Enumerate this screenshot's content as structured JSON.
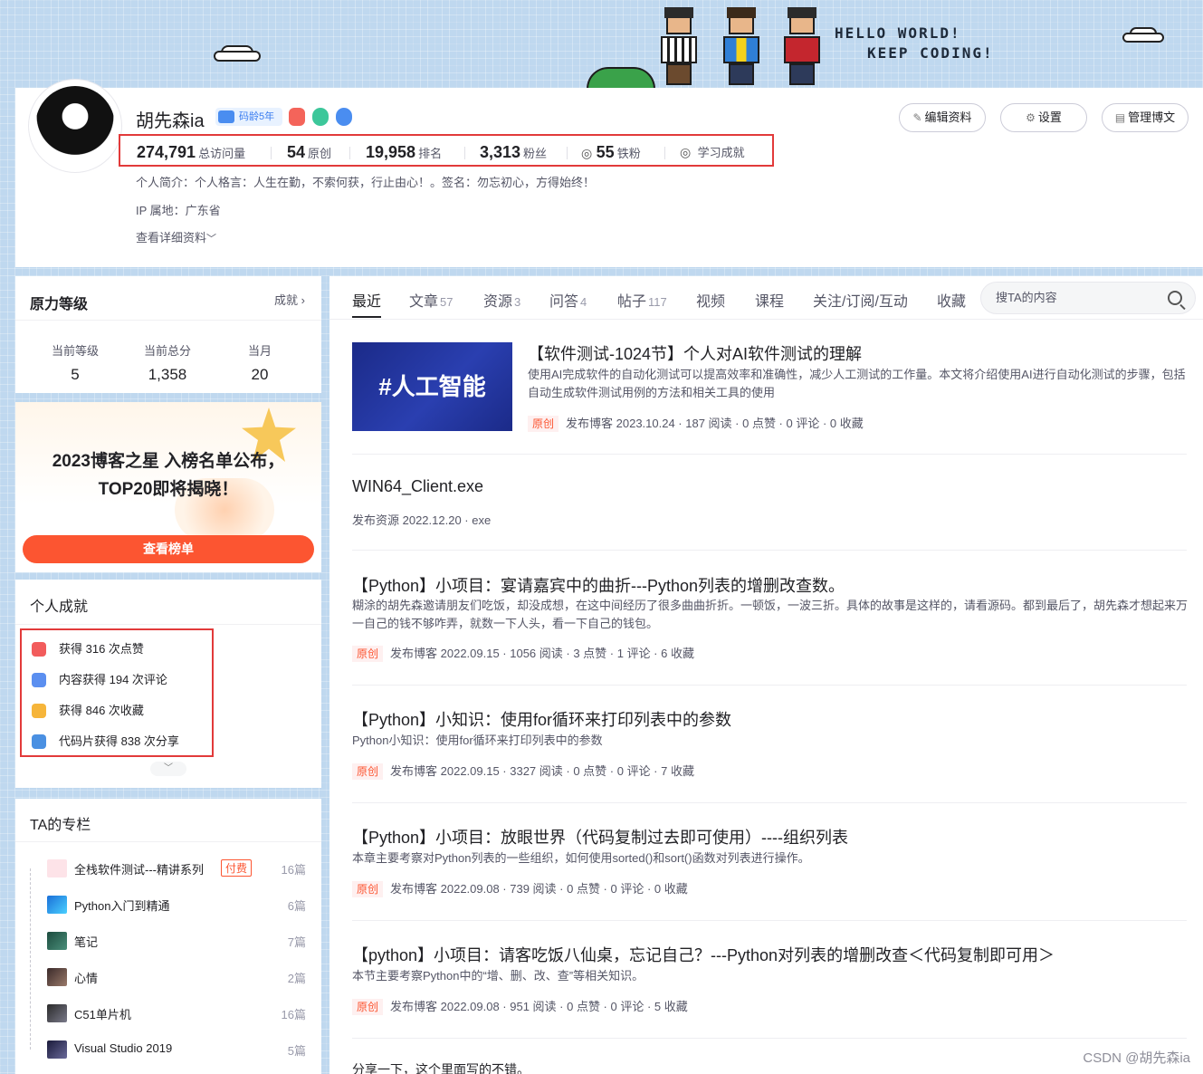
{
  "banner": {
    "hello_line1": "HELLO WORLD!",
    "hello_line2": "KEEP CODING!"
  },
  "profile": {
    "name": "胡先森ia",
    "code_age": "码龄5年",
    "stats": [
      {
        "num": "274,791",
        "label": "总访问量"
      },
      {
        "num": "54",
        "label": "原创"
      },
      {
        "num": "19,958",
        "label": "排名"
      },
      {
        "num": "3,313",
        "label": "粉丝"
      },
      {
        "num": "55",
        "label": "铁粉"
      },
      {
        "num": "",
        "label": "学习成就"
      }
    ],
    "intro": "个人简介：个人格言：人生在勤，不索何获，行止由心！。签名：勿忘初心，方得始终！",
    "ip": "IP 属地：广东省",
    "details": "查看详细资料",
    "buttons": {
      "edit": "编辑资料",
      "settings": "设置",
      "manage": "管理博文"
    }
  },
  "level": {
    "title": "原力等级",
    "link": "成就",
    "items": [
      {
        "label": "当前等级",
        "value": "5"
      },
      {
        "label": "当前总分",
        "value": "1,358"
      },
      {
        "label": "当月",
        "value": "20"
      }
    ]
  },
  "promo": {
    "line1": "2023博客之星 入榜名单公布，",
    "line2": "TOP20即将揭晓！",
    "button": "查看榜单"
  },
  "achievements": {
    "title": "个人成就",
    "items": [
      {
        "text": "获得 316 次点赞",
        "color": "#f25c5c"
      },
      {
        "text": "内容获得 194 次评论",
        "color": "#5b8ff0"
      },
      {
        "text": "获得 846 次收藏",
        "color": "#f6b53a"
      },
      {
        "text": "代码片获得 838 次分享",
        "color": "#4a90e2"
      }
    ]
  },
  "columns": {
    "title": "TA的专栏",
    "items": [
      {
        "name": "全栈软件测试---精讲系列",
        "tag": "付费",
        "count": "16篇"
      },
      {
        "name": "Python入门到精通",
        "tag": "",
        "count": "6篇"
      },
      {
        "name": "笔记",
        "tag": "",
        "count": "7篇"
      },
      {
        "name": "心情",
        "tag": "",
        "count": "2篇"
      },
      {
        "name": "C51单片机",
        "tag": "",
        "count": "16篇"
      },
      {
        "name": "Visual Studio 2019",
        "tag": "",
        "count": "5篇"
      }
    ]
  },
  "tabs": [
    {
      "label": "最近",
      "count": ""
    },
    {
      "label": "文章",
      "count": "57"
    },
    {
      "label": "资源",
      "count": "3"
    },
    {
      "label": "问答",
      "count": "4"
    },
    {
      "label": "帖子",
      "count": "117"
    },
    {
      "label": "视频",
      "count": ""
    },
    {
      "label": "课程",
      "count": ""
    },
    {
      "label": "关注/订阅/互动",
      "count": ""
    },
    {
      "label": "收藏",
      "count": ""
    }
  ],
  "search": {
    "placeholder": "搜TA的内容"
  },
  "articles": [
    {
      "thumb": "#人工智能",
      "title": "【软件测试-1024节】个人对AI软件测试的理解",
      "desc": "使用AI完成软件的自动化测试可以提高效率和准确性，减少人工测试的工作量。本文将介绍使用AI进行自动化测试的步骤，包括自动生成软件测试用例的方法和相关工具的使用",
      "orig": "原创",
      "meta": "发布博客 2023.10.24 · 187 阅读 · 0 点赞 · 0 评论 · 0 收藏"
    },
    {
      "title": "WIN64_Client.exe",
      "meta": "发布资源 2022.12.20 · exe"
    },
    {
      "title": "【Python】小项目：宴请嘉宾中的曲折---Python列表的增删改查数。",
      "desc": "糊涂的胡先森邀请朋友们吃饭，却没成想，在这中间经历了很多曲曲折折。一顿饭，一波三折。具体的故事是这样的，请看源码。都到最后了，胡先森才想起来万一自己的钱不够咋弄，就数一下人头，看一下自己的钱包。",
      "orig": "原创",
      "meta": "发布博客 2022.09.15 · 1056 阅读 · 3 点赞 · 1 评论 · 6 收藏"
    },
    {
      "title": "【Python】小知识：使用for循环来打印列表中的参数",
      "desc": "Python小知识：使用for循环来打印列表中的参数",
      "orig": "原创",
      "meta": "发布博客 2022.09.15 · 3327 阅读 · 0 点赞 · 0 评论 · 7 收藏"
    },
    {
      "title": "【Python】小项目：放眼世界（代码复制过去即可使用）----组织列表",
      "desc": "本章主要考察对Python列表的一些组织，如何使用sorted()和sort()函数对列表进行操作。",
      "orig": "原创",
      "meta": "发布博客 2022.09.08 · 739 阅读 · 0 点赞 · 0 评论 · 0 收藏"
    },
    {
      "title": "【python】小项目：请客吃饭八仙桌，忘记自己？---Python对列表的增删改查＜代码复制即可用＞",
      "desc": "本节主要考察Python中的“增、删、改、查”等相关知识。",
      "orig": "原创",
      "meta": "发布博客 2022.09.08 · 951 阅读 · 0 点赞 · 0 评论 · 5 收藏"
    },
    {
      "title": "分享一下，这个里面写的不错。"
    }
  ],
  "watermark": "CSDN @胡先森ia"
}
